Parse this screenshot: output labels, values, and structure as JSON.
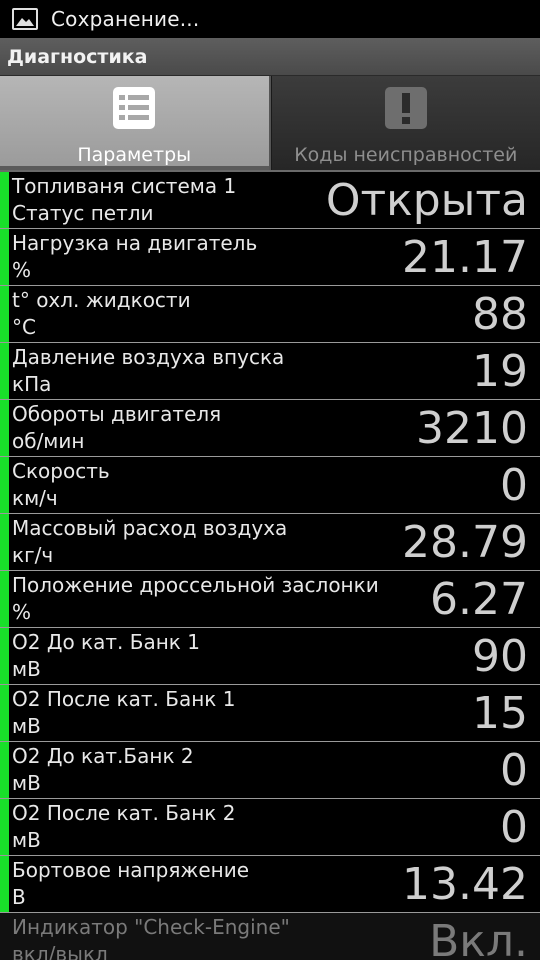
{
  "status_bar": {
    "icon": "image-icon",
    "text": "Сохранение..."
  },
  "title_bar": {
    "title": "Диагностика"
  },
  "tabs": [
    {
      "label": "Параметры",
      "icon": "list-icon",
      "active": true
    },
    {
      "label": "Коды неисправностей",
      "icon": "exclamation-icon",
      "active": false
    }
  ],
  "parameters": [
    {
      "name": "Топливаня система 1",
      "unit": "Статус петли",
      "value": "Открыта"
    },
    {
      "name": "Нагрузка на двигатель",
      "unit": "%",
      "value": "21.17"
    },
    {
      "name": "t° охл. жидкости",
      "unit": "°C",
      "value": "88"
    },
    {
      "name": "Давление воздуха впуска",
      "unit": "кПа",
      "value": "19"
    },
    {
      "name": "Обороты двигателя",
      "unit": "об/мин",
      "value": "3210"
    },
    {
      "name": "Скорость",
      "unit": "км/ч",
      "value": "0"
    },
    {
      "name": "Массовый расход воздуха",
      "unit": "кг/ч",
      "value": "28.79"
    },
    {
      "name": "Положение дроссельной заслонки",
      "unit": "%",
      "value": "6.27"
    },
    {
      "name": "O2 До кат. Банк 1",
      "unit": "мВ",
      "value": "90"
    },
    {
      "name": "O2 После кат. Банк 1",
      "unit": "мВ",
      "value": "15"
    },
    {
      "name": "O2 До кат.Банк 2",
      "unit": "мВ",
      "value": "0"
    },
    {
      "name": "O2 После кат. Банк 2",
      "unit": "мВ",
      "value": "0"
    },
    {
      "name": "Бортовое напряжение",
      "unit": "В",
      "value": "13.42"
    },
    {
      "name": "Индикатор \"Check-Engine\"",
      "unit": "вкл/выкл",
      "value": "Вкл."
    }
  ],
  "colors": {
    "indicator": "#19e02a",
    "background": "#000000"
  }
}
